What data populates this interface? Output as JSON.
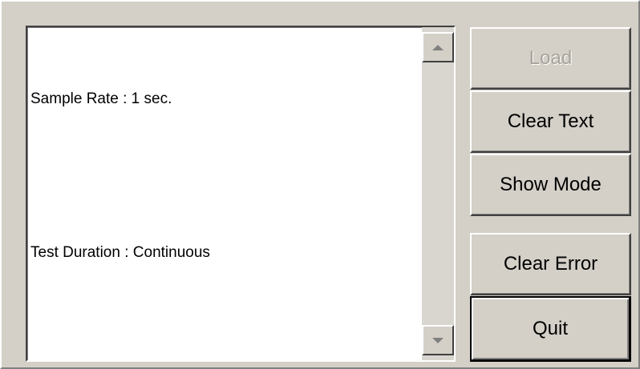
{
  "output": {
    "lines": [
      "Sample Rate : 1 sec.",
      "",
      "Test Duration : Continuous"
    ]
  },
  "scrollbar": {
    "up_icon": "scroll-up-arrow",
    "down_icon": "scroll-down-arrow"
  },
  "buttons": {
    "load": {
      "label": "Load",
      "enabled": false
    },
    "clear_text": {
      "label": "Clear Text",
      "enabled": true
    },
    "show_mode": {
      "label": "Show Mode",
      "enabled": true
    },
    "clear_error": {
      "label": "Clear Error",
      "enabled": true
    },
    "quit": {
      "label": "Quit",
      "enabled": true,
      "default": true
    }
  },
  "colors": {
    "face": "#d4d0c8",
    "disabled_text": "#a7a39b"
  }
}
